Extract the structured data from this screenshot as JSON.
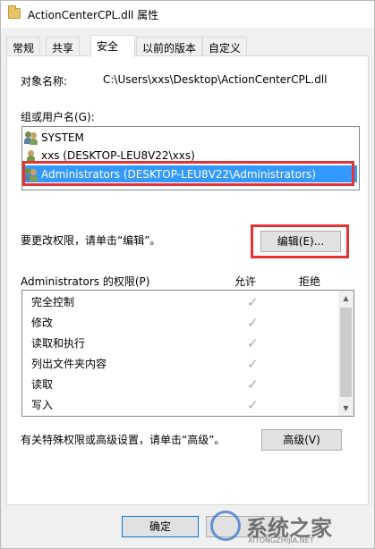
{
  "window": {
    "title": "ActionCenterCPL.dll 属性"
  },
  "tabs": [
    {
      "label": "常规",
      "active": false
    },
    {
      "label": "共享",
      "active": false
    },
    {
      "label": "安全",
      "active": true
    },
    {
      "label": "以前的版本",
      "active": false
    },
    {
      "label": "自定义",
      "active": false
    }
  ],
  "security": {
    "object_name_label": "对象名称:",
    "object_name_value": "C:\\Users\\xxs\\Desktop\\ActionCenterCPL.dll",
    "group_label": "组或用户名(G):",
    "users": [
      {
        "name": "SYSTEM",
        "icon": "group-users-icon",
        "selected": false
      },
      {
        "name": "xxs (DESKTOP-LEU8V22\\xxs)",
        "icon": "user-icon",
        "selected": false
      },
      {
        "name": "Administrators (DESKTOP-LEU8V22\\Administrators)",
        "icon": "group-users-icon",
        "selected": true
      }
    ],
    "edit_hint": "要更改权限，请单击“编辑”。",
    "edit_button": "编辑(E)...",
    "permissions_title": "Administrators 的权限(P)",
    "allow_header": "允许",
    "deny_header": "拒绝",
    "permissions": [
      {
        "name": "完全控制",
        "allow": true,
        "deny": false
      },
      {
        "name": "修改",
        "allow": true,
        "deny": false
      },
      {
        "name": "读取和执行",
        "allow": true,
        "deny": false
      },
      {
        "name": "列出文件夹内容",
        "allow": true,
        "deny": false
      },
      {
        "name": "读取",
        "allow": true,
        "deny": false
      },
      {
        "name": "写入",
        "allow": true,
        "deny": false
      }
    ],
    "advanced_hint": "有关特殊权限或高级设置，请单击“高级”。",
    "advanced_button": "高级(V)"
  },
  "footer": {
    "ok_button": "确定"
  },
  "watermark": {
    "text": "系统之家",
    "url": "XITONGZHIJIA.NET"
  },
  "colors": {
    "selection": "#3399ff",
    "highlight": "#e53333"
  }
}
